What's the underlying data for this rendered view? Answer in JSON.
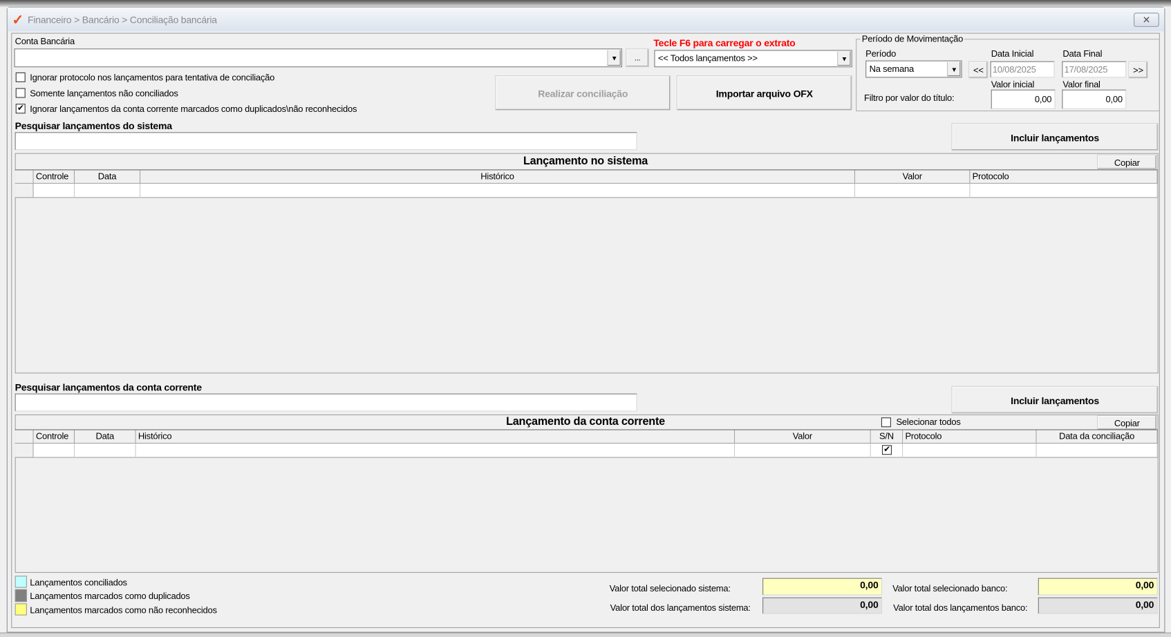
{
  "window": {
    "breadcrumb": "Financeiro > Bancário > Conciliação bancária",
    "close_icon": "close-icon"
  },
  "conta": {
    "label": "Conta Bancária",
    "value": "",
    "browse_label": "..."
  },
  "extrato": {
    "hint": "Tecle F6 para carregar o extrato",
    "hint_color": "#ff0000",
    "selected": "<< Todos lançamentos >>"
  },
  "options": [
    {
      "label": "Ignorar protocolo nos lançamentos para tentativa de conciliação",
      "checked": false
    },
    {
      "label": "Somente lançamentos não conciliados",
      "checked": false
    },
    {
      "label": "Ignorar lançamentos da conta corrente marcados como duplicados\\não reconhecidos",
      "checked": true
    }
  ],
  "buttons": {
    "realizar": "Realizar conciliação",
    "importar": "Importar arquivo OFX",
    "incluir": "Incluir lançamentos",
    "copiar": "Copiar"
  },
  "periodo": {
    "group_title": "Período de Movimentação",
    "periodo_label": "Período",
    "periodo_value": "Na semana",
    "prev_label": "<<",
    "next_label": ">>",
    "data_inicial_label": "Data Inicial",
    "data_inicial": "10/08/2025",
    "data_final_label": "Data Final",
    "data_final": "17/08/2025",
    "filtro_label": "Filtro por valor do título:",
    "valor_inicial_label": "Valor inicial",
    "valor_inicial": "0,00",
    "valor_final_label": "Valor final",
    "valor_final": "0,00"
  },
  "sistema": {
    "search_label": "Pesquisar lançamentos do sistema",
    "search_value": "",
    "grid_title": "Lançamento no sistema",
    "columns": [
      "Controle",
      "Data",
      "Histórico",
      "Valor",
      "Protocolo"
    ]
  },
  "conta_corrente": {
    "search_label": "Pesquisar lançamentos da conta corrente",
    "search_value": "",
    "grid_title": "Lançamento da conta corrente",
    "select_all_label": "Selecionar todos",
    "columns": [
      "Controle",
      "Data",
      "Histórico",
      "Valor",
      "S/N",
      "Protocolo",
      "Data da conciliação"
    ],
    "row_sn_checked": true
  },
  "legend": [
    {
      "label": "Lançamentos conciliados",
      "color": "#c0ffff"
    },
    {
      "label": "Lançamentos marcados como duplicados",
      "color": "#808080"
    },
    {
      "label": "Lançamentos marcados como não reconhecidos",
      "color": "#ffff80"
    }
  ],
  "totals": {
    "sel_sistema_label": "Valor total selecionado sistema:",
    "sel_sistema": "0,00",
    "tot_sistema_label": "Valor total dos lançamentos sistema:",
    "tot_sistema": "0,00",
    "sel_banco_label": "Valor total selecionado banco:",
    "sel_banco": "0,00",
    "tot_banco_label": "Valor total dos lançamentos banco:",
    "tot_banco": "0,00",
    "selected_color": "#ffffc0",
    "total_color": "#e3e3e3"
  }
}
